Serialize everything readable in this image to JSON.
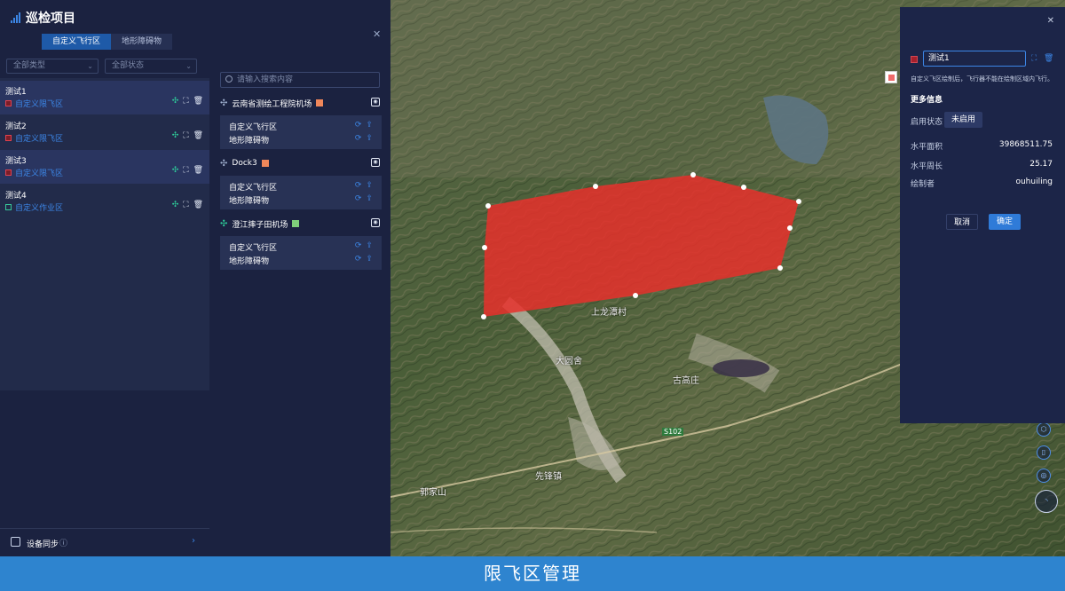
{
  "app": {
    "title": "巡检项目",
    "tabs": [
      "自定义飞行区",
      "地形障碍物"
    ],
    "filter_type": "全部类型",
    "filter_status": "全部状态"
  },
  "zones": [
    {
      "name": "测试1",
      "type": "自定义限飞区",
      "type_color": "#e0424f"
    },
    {
      "name": "测试2",
      "type": "自定义限飞区",
      "type_color": "#e0424f"
    },
    {
      "name": "测试3",
      "type": "自定义限飞区",
      "type_color": "#e0424f"
    },
    {
      "name": "测试4",
      "type": "自定义作业区",
      "type_color": "#37c99a"
    }
  ],
  "device_sync": {
    "label": "设备同步"
  },
  "middle": {
    "search_placeholder": "请输入搜索内容",
    "sites": [
      {
        "name": "云南省测绘工程院机场",
        "color": "#f0875a",
        "rows": [
          "自定义飞行区",
          "地形障碍物"
        ]
      },
      {
        "name": "Dock3",
        "color": "#f0875a",
        "rows": [
          "自定义飞行区",
          "地形障碍物"
        ]
      },
      {
        "name": "澄江摔子田机场",
        "color": "#7fcf7a",
        "rows": [
          "自定义飞行区",
          "地形障碍物"
        ]
      }
    ]
  },
  "map": {
    "labels": [
      "上龙潭村",
      "大圆舍",
      "古高庄",
      "先锋镇",
      "郭家山"
    ],
    "roads": [
      "S102"
    ],
    "zone_fill": "#e8302c"
  },
  "detail": {
    "name_value": "测试1",
    "description": "自定义飞区绘制后，飞行器不能在绘制区域内飞行。",
    "more_info": "更多信息",
    "status_label": "启用状态",
    "status_value": "未启用",
    "area_label": "水平面积",
    "area_value": "39868511.75",
    "perimeter_label": "水平周长",
    "perimeter_value": "25.17",
    "creator_label": "绘制者",
    "creator_value": "ouhuiling",
    "cancel": "取消",
    "confirm": "确定"
  },
  "caption": "限飞区管理"
}
